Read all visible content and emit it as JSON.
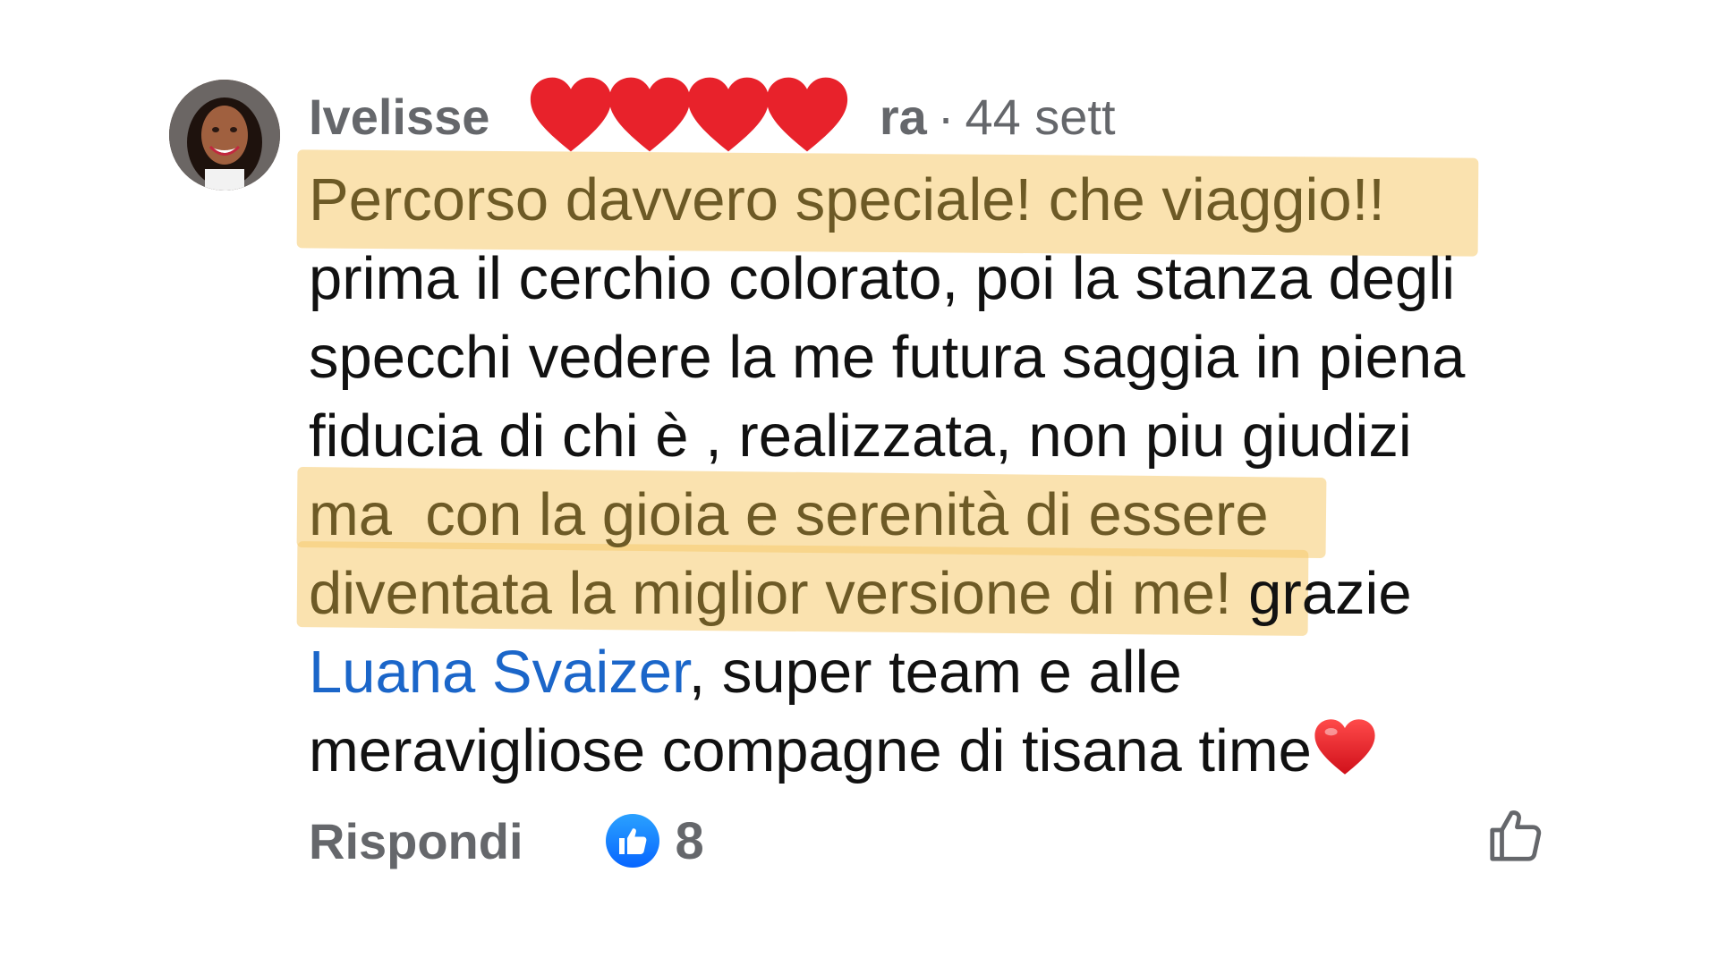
{
  "comment": {
    "author_visible": "Ivelisse",
    "author_hidden_tail": "ra",
    "separator": "·",
    "time": "44 sett",
    "lines": [
      {
        "highlight": "Percorso davvero speciale! che viaggio!!",
        "rest": ""
      },
      {
        "highlight": "",
        "rest": "prima il cerchio colorato, poi la stanza degli"
      },
      {
        "highlight": "",
        "rest": "specchi vedere la me futura saggia in piena"
      },
      {
        "highlight": "",
        "rest": "fiducia di chi è , realizzata, non piu giudizi"
      },
      {
        "highlight": "ma  con la gioia e serenità di essere",
        "rest": ""
      },
      {
        "highlight": "diventata la miglior versione di me!",
        "rest": " grazie"
      },
      {
        "mention": "Luana Svaizer",
        "rest": ", super team e alle"
      },
      {
        "highlight": "",
        "rest": "meravigliose compagne di tisana time"
      }
    ],
    "emoji": "heart-emoji"
  },
  "footer": {
    "reply_label": "Rispondi",
    "reaction_icon": "like-reaction-icon",
    "reaction_count": "8",
    "like_button_icon": "thumbs-up-outline-icon"
  },
  "colors": {
    "meta_gray": "#65676b",
    "text": "#111111",
    "mention_blue": "#1b66c9",
    "highlight": "#f5cb6e",
    "heart_red": "#e8222b",
    "like_blue": "#0866ff"
  }
}
